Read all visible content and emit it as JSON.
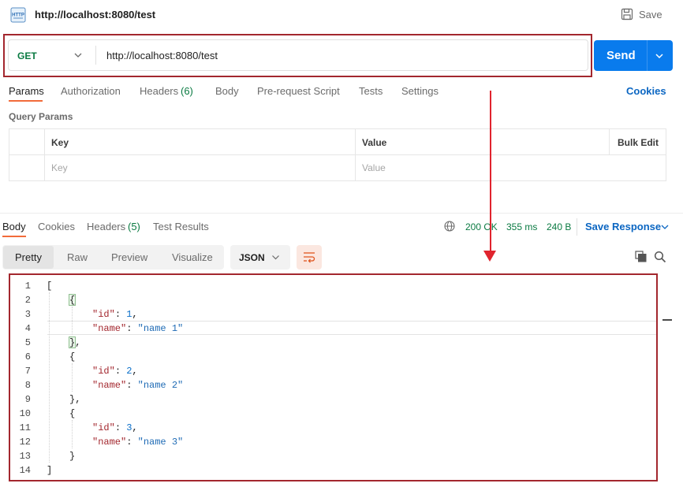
{
  "title_bar": {
    "icon": "http-file-icon",
    "title": "http://localhost:8080/test",
    "save_label": "Save"
  },
  "request": {
    "method": "GET",
    "url": "http://localhost:8080/test",
    "send_label": "Send"
  },
  "request_tabs": [
    {
      "label": "Params"
    },
    {
      "label": "Authorization"
    },
    {
      "label": "Headers",
      "count": "(6)"
    },
    {
      "label": "Body"
    },
    {
      "label": "Pre-request Script"
    },
    {
      "label": "Tests"
    },
    {
      "label": "Settings"
    }
  ],
  "cookies_link": "Cookies",
  "query_params": {
    "label": "Query Params",
    "columns": [
      "Key",
      "Value",
      "Bulk Edit"
    ],
    "placeholders": {
      "key": "Key",
      "value": "Value"
    }
  },
  "response_tabs": [
    {
      "label": "Body"
    },
    {
      "label": "Cookies"
    },
    {
      "label": "Headers",
      "count": "(5)"
    },
    {
      "label": "Test Results"
    }
  ],
  "response_status": {
    "status": "200 OK",
    "time": "355 ms",
    "size": "240 B",
    "save_response": "Save Response"
  },
  "view_modes": [
    "Pretty",
    "Raw",
    "Preview",
    "Visualize"
  ],
  "format": "JSON",
  "code": {
    "line_numbers": [
      "1",
      "2",
      "3",
      "4",
      "5",
      "6",
      "7",
      "8",
      "9",
      "10",
      "11",
      "12",
      "13",
      "14"
    ],
    "items": [
      {
        "id_key": "\"id\"",
        "id_val": "1",
        "name_key": "\"name\"",
        "name_val": "\"name 1\""
      },
      {
        "id_key": "\"id\"",
        "id_val": "2",
        "name_key": "\"name\"",
        "name_val": "\"name 2\""
      },
      {
        "id_key": "\"id\"",
        "id_val": "3",
        "name_key": "\"name\"",
        "name_val": "\"name 3\""
      }
    ],
    "open_array": "[",
    "close_array": "]",
    "open_obj": "{",
    "close_obj_comma": "},",
    "close_obj": "}"
  },
  "colors": {
    "accent_orange": "#f26b3a",
    "send_blue": "#097bed",
    "link_blue": "#0b66c2",
    "status_green": "#0a7a42",
    "highlight_red": "#a3272e",
    "arrow_red": "#e0242e"
  }
}
